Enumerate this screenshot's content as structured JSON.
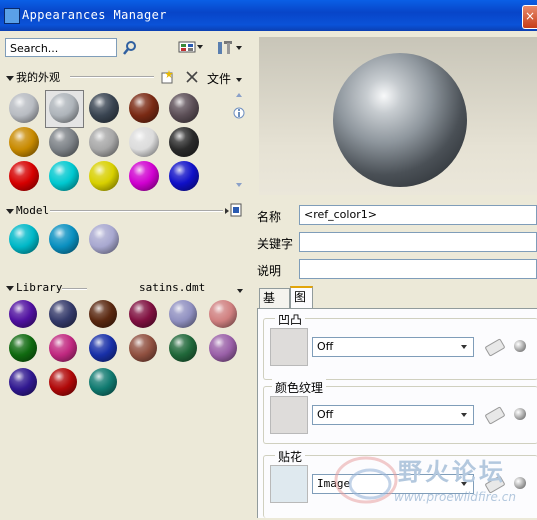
{
  "window": {
    "title": "Appearances Manager",
    "close_label": "×"
  },
  "search": {
    "placeholder": "Search..."
  },
  "toolbar": {
    "file_menu_label": "文件"
  },
  "my_appearances": {
    "label": "我的外观",
    "balls": [
      {
        "name": "gray",
        "color": "#b8bcc2"
      },
      {
        "name": "silver-selected",
        "color": "#aeb4ba"
      },
      {
        "name": "dark-slate",
        "color": "#3a4552"
      },
      {
        "name": "rust",
        "color": "#7a2a14"
      },
      {
        "name": "granite",
        "color": "#5c4f57"
      },
      {
        "name": "gold",
        "color": "#c88a00"
      },
      {
        "name": "gunmetal",
        "color": "#7d8287"
      },
      {
        "name": "light-gray",
        "color": "#a8a8a8"
      },
      {
        "name": "white",
        "color": "#dcdcdc"
      },
      {
        "name": "black",
        "color": "#2a2a2a"
      },
      {
        "name": "red",
        "color": "#d60000"
      },
      {
        "name": "cyan",
        "color": "#00c8d0"
      },
      {
        "name": "yellow",
        "color": "#d8d000"
      },
      {
        "name": "magenta",
        "color": "#d000d0"
      },
      {
        "name": "blue",
        "color": "#1010c8"
      }
    ]
  },
  "model": {
    "label": "Model",
    "balls": [
      {
        "name": "cyan",
        "color": "#00b8c8"
      },
      {
        "name": "teal-blue",
        "color": "#0a90c0"
      },
      {
        "name": "lavender",
        "color": "#a8a8d0"
      }
    ]
  },
  "library": {
    "label": "Library",
    "file": "satins.dmt",
    "balls": [
      {
        "name": "purple-satin",
        "color": "#5010a0"
      },
      {
        "name": "navy-satin",
        "color": "#343a6a"
      },
      {
        "name": "brown-satin",
        "color": "#5a2810"
      },
      {
        "name": "maroon-satin",
        "color": "#801040"
      },
      {
        "name": "lilac-satin",
        "color": "#9090c0"
      },
      {
        "name": "rose-satin",
        "color": "#d08080"
      },
      {
        "name": "green-satin",
        "color": "#106a10"
      },
      {
        "name": "pink-satin",
        "color": "#c02880"
      },
      {
        "name": "blue-satin",
        "color": "#1830a8"
      },
      {
        "name": "copper-satin",
        "color": "#905040"
      },
      {
        "name": "forest-satin",
        "color": "#20683a"
      },
      {
        "name": "mauve-satin",
        "color": "#9a60a8"
      },
      {
        "name": "violet-satin",
        "color": "#301890"
      },
      {
        "name": "crimson-satin",
        "color": "#b00808"
      },
      {
        "name": "teal-satin",
        "color": "#107a70"
      }
    ]
  },
  "properties": {
    "name_label": "名称",
    "name_value": "<ref_color1>",
    "keywords_label": "关键字",
    "keywords_value": "",
    "description_label": "说明",
    "description_value": ""
  },
  "tabs": {
    "basic": "基本",
    "map": "图"
  },
  "map": {
    "bump": {
      "label": "凹凸",
      "value": "Off"
    },
    "color_texture": {
      "label": "颜色纹理",
      "value": "Off"
    },
    "decal": {
      "label": "贴花",
      "value": "Image"
    }
  },
  "watermark": {
    "text": "野火论坛",
    "url": "www.proewildfire.cn"
  },
  "colors": {
    "titlebar": "#0a52d8",
    "accent_tab": "#e2a50a",
    "panel_bg": "#ece9d8"
  }
}
